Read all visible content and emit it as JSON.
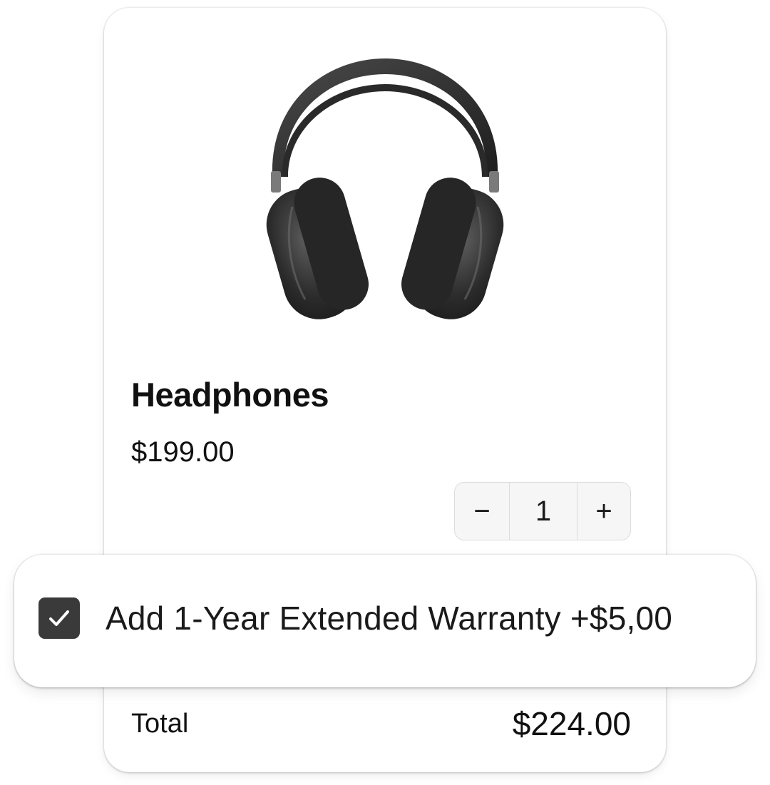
{
  "product": {
    "name": "Headphones",
    "price": "$199.00",
    "image_icon": "headphones-icon"
  },
  "quantity": {
    "decrement_label": "−",
    "value": "1",
    "increment_label": "+"
  },
  "warranty": {
    "checked": true,
    "label": "Add 1-Year Extended Warranty +$5,00",
    "checkbox_icon": "checkmark-icon",
    "checkbox_color": "#3a3a3a"
  },
  "summary": {
    "total_label": "Total",
    "total_value": "$224.00"
  }
}
